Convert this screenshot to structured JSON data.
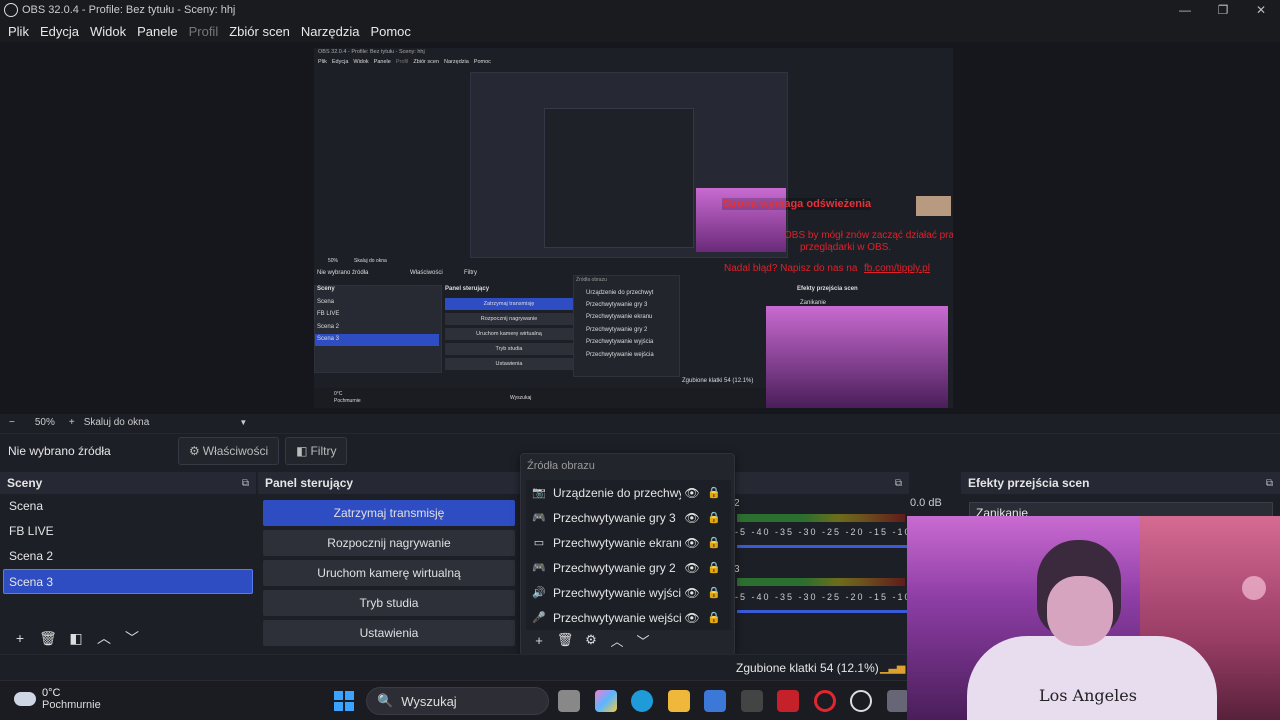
{
  "window": {
    "title": "OBS 32.0.4 - Profile: Bez tytułu - Sceny: hhj",
    "minimize": "—",
    "maximize": "❐",
    "close": "✕"
  },
  "menu": {
    "items": [
      "Plik",
      "Edycja",
      "Widok",
      "Panele",
      "Profil",
      "Zbiór scen",
      "Narzędzia",
      "Pomoc"
    ]
  },
  "nested": {
    "title": "OBS 32.0.4 - Profile: Bez tytułu - Sceny: hhj",
    "menu": [
      "Plik",
      "Edycja",
      "Widok",
      "Panele",
      "Profil",
      "Zbiór scen",
      "Narzędzia",
      "Pomoc"
    ],
    "banner": "Strona wymaga odświeżenia",
    "message1": "OBS by mógł znów zacząć działać prawidłowo. Jeśli to nie pomoże, odśwież",
    "message2": "przeglądarki w OBS.",
    "message3": "Nadal błąd? Napisz do nas na",
    "link": "fb.com/tipply.pl",
    "zoom": "50%",
    "scale": "Skaluj do okna",
    "nosel": "Nie wybrano źródła",
    "props": "Właściwości",
    "filters": "Filtry",
    "scenes_head": "Sceny",
    "controls_head": "Panel sterujący",
    "trans_head": "Efekty przejścia scen",
    "trans_value": "Zanikanie",
    "scenes": [
      "Scena",
      "FB LIVE",
      "Scena 2",
      "Scena 3"
    ],
    "controls": [
      "Zatrzymaj transmisję",
      "Rozpocznij nagrywanie",
      "Uruchom kamerę wirtualną",
      "Tryb studia",
      "Ustawienia"
    ],
    "sources_title": "Źródła obrazu",
    "sources": [
      "Urządzenie do przechwyt",
      "Przechwytywanie gry 3",
      "Przechwytywanie ekranu",
      "Przechwytywanie gry 2",
      "Przechwytywanie wyjścia",
      "Przechwytywanie wejścia"
    ],
    "dropped": "Zgubione klatki 54 (12.1%)",
    "weather_temp": "0°C",
    "weather_desc": "Pochmurnie",
    "search": "Wyszukaj"
  },
  "zoombar": {
    "minus": "−",
    "zoom": "50%",
    "plus": "+",
    "scale": "Skaluj do okna",
    "arrow": "▼"
  },
  "sourcebar": {
    "nosel": "Nie wybrano źródła",
    "props": "Właściwości",
    "filters": "Filtry"
  },
  "scenes": {
    "title": "Sceny",
    "items": [
      "Scena",
      "FB LIVE",
      "Scena 2",
      "Scena 3"
    ],
    "active": 3
  },
  "controls": {
    "title": "Panel sterujący",
    "buttons": [
      "Zatrzymaj transmisję",
      "Rozpocznij nagrywanie",
      "Uruchom kamerę wirtualną",
      "Tryb studia",
      "Ustawienia"
    ]
  },
  "sources": {
    "title": "Źródła obrazu",
    "items": [
      {
        "name": "Urządzenie do przechwyt",
        "icon": "camera-icon",
        "glyph": "📷"
      },
      {
        "name": "Przechwytywanie gry 3",
        "icon": "gamepad-icon",
        "glyph": "🎮"
      },
      {
        "name": "Przechwytywanie ekranu",
        "icon": "monitor-icon",
        "glyph": "▭"
      },
      {
        "name": "Przechwytywanie gry 2",
        "icon": "gamepad-icon",
        "glyph": "🎮"
      },
      {
        "name": "Przechwytywanie wyjścia",
        "icon": "speaker-icon",
        "glyph": "🔊"
      },
      {
        "name": "Przechwytywanie wejścia",
        "icon": "microphone-icon",
        "glyph": "🎤"
      }
    ]
  },
  "mixer": {
    "db": "0.0 dB",
    "ch1": "2",
    "ch2": "3",
    "scale": "-5 -40 -35 -30 -25 -20 -15 -10"
  },
  "transitions": {
    "title": "Efekty przejścia scen",
    "value": "Zanikanie"
  },
  "status": {
    "dropped": "Zgubione klatki 54 (12.1%)"
  },
  "taskbar": {
    "temp": "0°C",
    "desc": "Pochmurnie",
    "search": "Wyszukaj"
  },
  "webcam": {
    "shirt_text": "Los Angeles"
  },
  "colors": {
    "accent": "#2f4dc2",
    "error": "#e0202a",
    "bg": "#1d1f26"
  }
}
